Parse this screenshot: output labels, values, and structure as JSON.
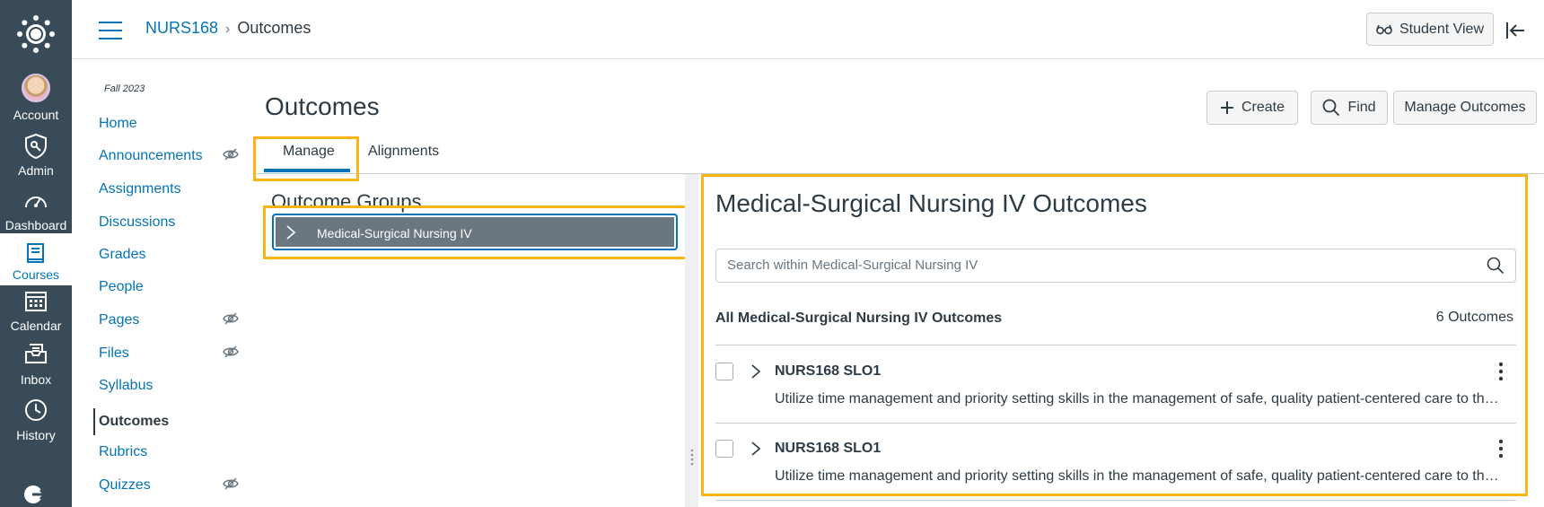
{
  "global_nav": {
    "items": [
      {
        "label": "Account",
        "icon": "account-avatar"
      },
      {
        "label": "Admin",
        "icon": "shield-icon"
      },
      {
        "label": "Dashboard",
        "icon": "speedometer-icon"
      },
      {
        "label": "Courses",
        "icon": "book-icon",
        "active": true
      },
      {
        "label": "Calendar",
        "icon": "calendar-icon"
      },
      {
        "label": "Inbox",
        "icon": "inbox-icon"
      },
      {
        "label": "History",
        "icon": "clock-icon"
      }
    ]
  },
  "header": {
    "breadcrumb": {
      "course": "NURS168",
      "separator": "›",
      "current": "Outcomes"
    },
    "student_view_label": "Student View"
  },
  "course_nav": {
    "term": "Fall 2023",
    "items": [
      {
        "label": "Home"
      },
      {
        "label": "Announcements",
        "hidden": true
      },
      {
        "label": "Assignments"
      },
      {
        "label": "Discussions"
      },
      {
        "label": "Grades"
      },
      {
        "label": "People"
      },
      {
        "label": "Pages",
        "hidden": true
      },
      {
        "label": "Files",
        "hidden": true
      },
      {
        "label": "Syllabus"
      },
      {
        "label": "Outcomes",
        "active": true
      },
      {
        "label": "Rubrics"
      },
      {
        "label": "Quizzes",
        "hidden": true
      }
    ]
  },
  "main": {
    "title": "Outcomes",
    "actions": {
      "create": "Create",
      "find": "Find",
      "manage": "Manage Outcomes"
    },
    "tabs": [
      {
        "label": "Manage",
        "selected": true
      },
      {
        "label": "Alignments"
      }
    ],
    "outcome_groups": {
      "title": "Outcome Groups",
      "items": [
        {
          "label": "Medical-Surgical Nursing IV"
        }
      ]
    },
    "details": {
      "title": "Medical-Surgical Nursing IV Outcomes",
      "search_placeholder": "Search within Medical-Surgical Nursing IV",
      "all_label": "All Medical-Surgical Nursing IV Outcomes",
      "count": "6 Outcomes",
      "outcomes": [
        {
          "name": "NURS168 SLO1",
          "description": "Utilize time management and priority setting skills in the management of safe, quality patient-centered care to the diverse adult patient population."
        },
        {
          "name": "NURS168 SLO1",
          "description": "Utilize time management and priority setting skills in the management of safe, quality patient-centered care to the diverse adult patient population."
        }
      ]
    }
  },
  "colors": {
    "nav_bg": "#394b58",
    "link": "#0374b5",
    "highlight": "#fbb416",
    "group_bg": "#6b7780"
  }
}
